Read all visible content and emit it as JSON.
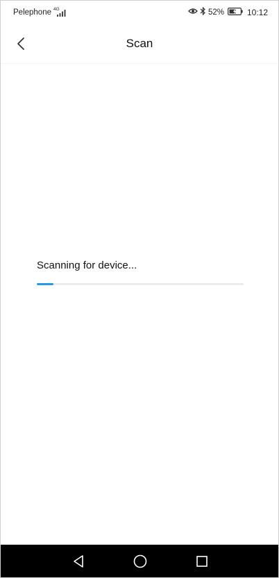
{
  "status_bar": {
    "carrier": "Pelephone",
    "network_type": "4G",
    "battery_percent": "52%",
    "time": "10:12",
    "icons": [
      "signal-icon",
      "eye-comfort-icon",
      "bluetooth-icon",
      "battery-icon"
    ]
  },
  "header": {
    "title": "Scan",
    "back_icon": "chevron-left-icon"
  },
  "scan": {
    "label": "Scanning for device...",
    "progress_fraction": 0.08
  },
  "nav_bar": {
    "icons": [
      "back-triangle-icon",
      "home-circle-icon",
      "recents-square-icon"
    ]
  },
  "colors": {
    "accent": "#1f9bea",
    "track": "#ececec",
    "nav_background": "#000000",
    "background": "#ffffff"
  }
}
